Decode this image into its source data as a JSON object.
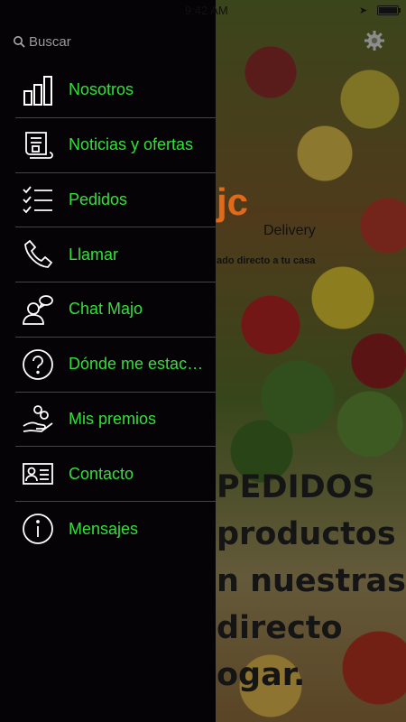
{
  "status_bar": {
    "time": "9:42 AM",
    "battery_percent": 100
  },
  "drawer": {
    "search": {
      "placeholder": "Buscar",
      "icon": "search-icon"
    },
    "menu": [
      {
        "label": "Nosotros",
        "icon": "bar-chart-icon"
      },
      {
        "label": "Noticias y ofertas",
        "icon": "scroll-document-icon"
      },
      {
        "label": "Pedidos",
        "icon": "checklist-icon"
      },
      {
        "label": "Llamar",
        "icon": "phone-icon"
      },
      {
        "label": "Chat Majo",
        "icon": "chat-person-icon"
      },
      {
        "label": "Dónde me estac…",
        "icon": "question-circle-icon"
      },
      {
        "label": "Mis premios",
        "icon": "hand-coins-icon"
      },
      {
        "label": "Contacto",
        "icon": "contact-card-icon"
      },
      {
        "label": "Mensajes",
        "icon": "info-circle-icon"
      }
    ],
    "accent_color": "#33e03a"
  },
  "background": {
    "logo_fragment": "jc",
    "subtitle": "Delivery",
    "tagline": "ado directo a tu casa",
    "promo_lines": [
      "PEDIDOS",
      "productos",
      "n nuestras",
      "directo",
      "ogar."
    ]
  },
  "settings": {
    "icon": "gear-icon"
  }
}
